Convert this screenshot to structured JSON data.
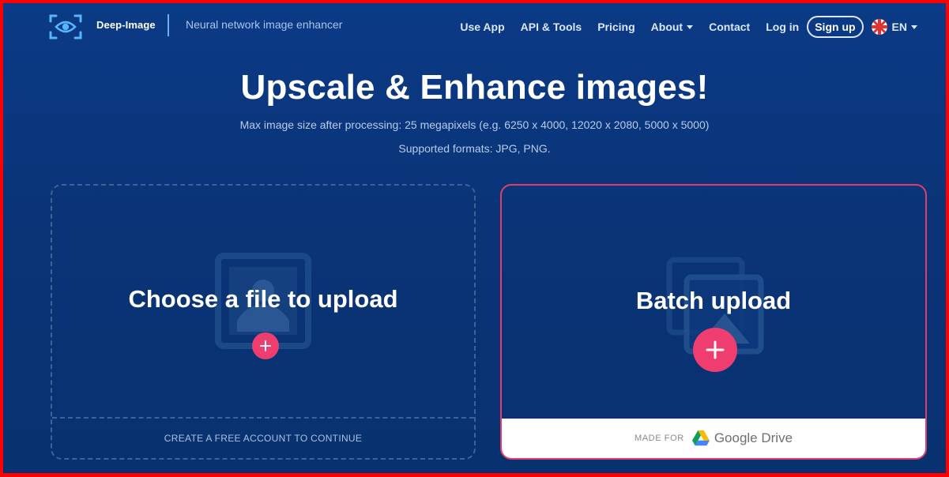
{
  "brand": {
    "name": "Deep-Image",
    "tagline": "Neural network image enhancer",
    "logo_icon": "eye-scan-icon"
  },
  "nav": {
    "items": [
      {
        "label": "Use App"
      },
      {
        "label": "API & Tools"
      },
      {
        "label": "Pricing"
      },
      {
        "label": "About",
        "dropdown": true
      },
      {
        "label": "Contact"
      },
      {
        "label": "Log in"
      }
    ],
    "signup_label": "Sign up",
    "language": {
      "code": "EN",
      "flag_icon": "uk-flag-icon"
    }
  },
  "hero": {
    "title": "Upscale & Enhance images!",
    "max_size": "Max image size after processing: 25 megapixels (e.g. 6250 x 4000, 12020 x 2080, 5000 x 5000)",
    "formats": "Supported formats: JPG, PNG."
  },
  "upload": {
    "single": {
      "title": "Choose a file to upload",
      "footer": "CREATE A FREE ACCOUNT TO CONTINUE",
      "icon": "image-placeholder-icon"
    },
    "batch": {
      "title": "Batch upload",
      "made_for": "MADE FOR",
      "service": "Google Drive",
      "icon": "images-stack-icon"
    }
  },
  "colors": {
    "accent": "#ef3d6f",
    "background": "#0a3477",
    "frame_border": "#ff0000"
  }
}
